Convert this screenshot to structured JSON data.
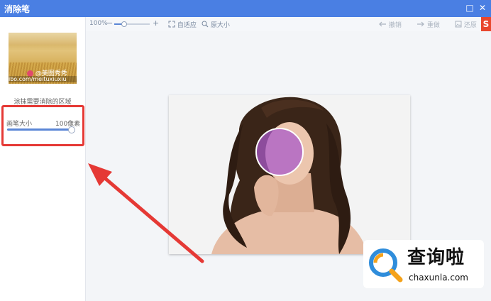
{
  "window": {
    "title": "消除笔",
    "maximize_glyph": "□",
    "close_glyph": "✕"
  },
  "sidebar": {
    "preview_watermark_handle": "@美图秀秀",
    "preview_watermark_url": "ibo.com/meituxiuxiu",
    "hint": "涂抹需要消除的区域",
    "brush_size_label": "画笔大小",
    "brush_size_value": "100像素",
    "brush_size_fraction": 0.95
  },
  "toolbar": {
    "zoom_percent": "100%",
    "zoom_minus": "−",
    "zoom_plus": "+",
    "fit_label": "自适应",
    "original_size_label": "原大小",
    "undo_label": "撤销",
    "redo_label": "重做",
    "restore_label": "还原"
  },
  "overlay": {
    "logo_text": "查询啦",
    "logo_url": "chaxunla.com",
    "brand_badge": "S"
  },
  "colors": {
    "titlebar": "#4a7fe3",
    "highlight_box": "#e53935",
    "arrow": "#e53935",
    "brush_circle": "#aa5ac8"
  },
  "icons": [
    "fit-icon",
    "magnifier-icon",
    "undo-arrow-icon",
    "redo-arrow-icon",
    "restore-icon",
    "search-logo-icon"
  ]
}
